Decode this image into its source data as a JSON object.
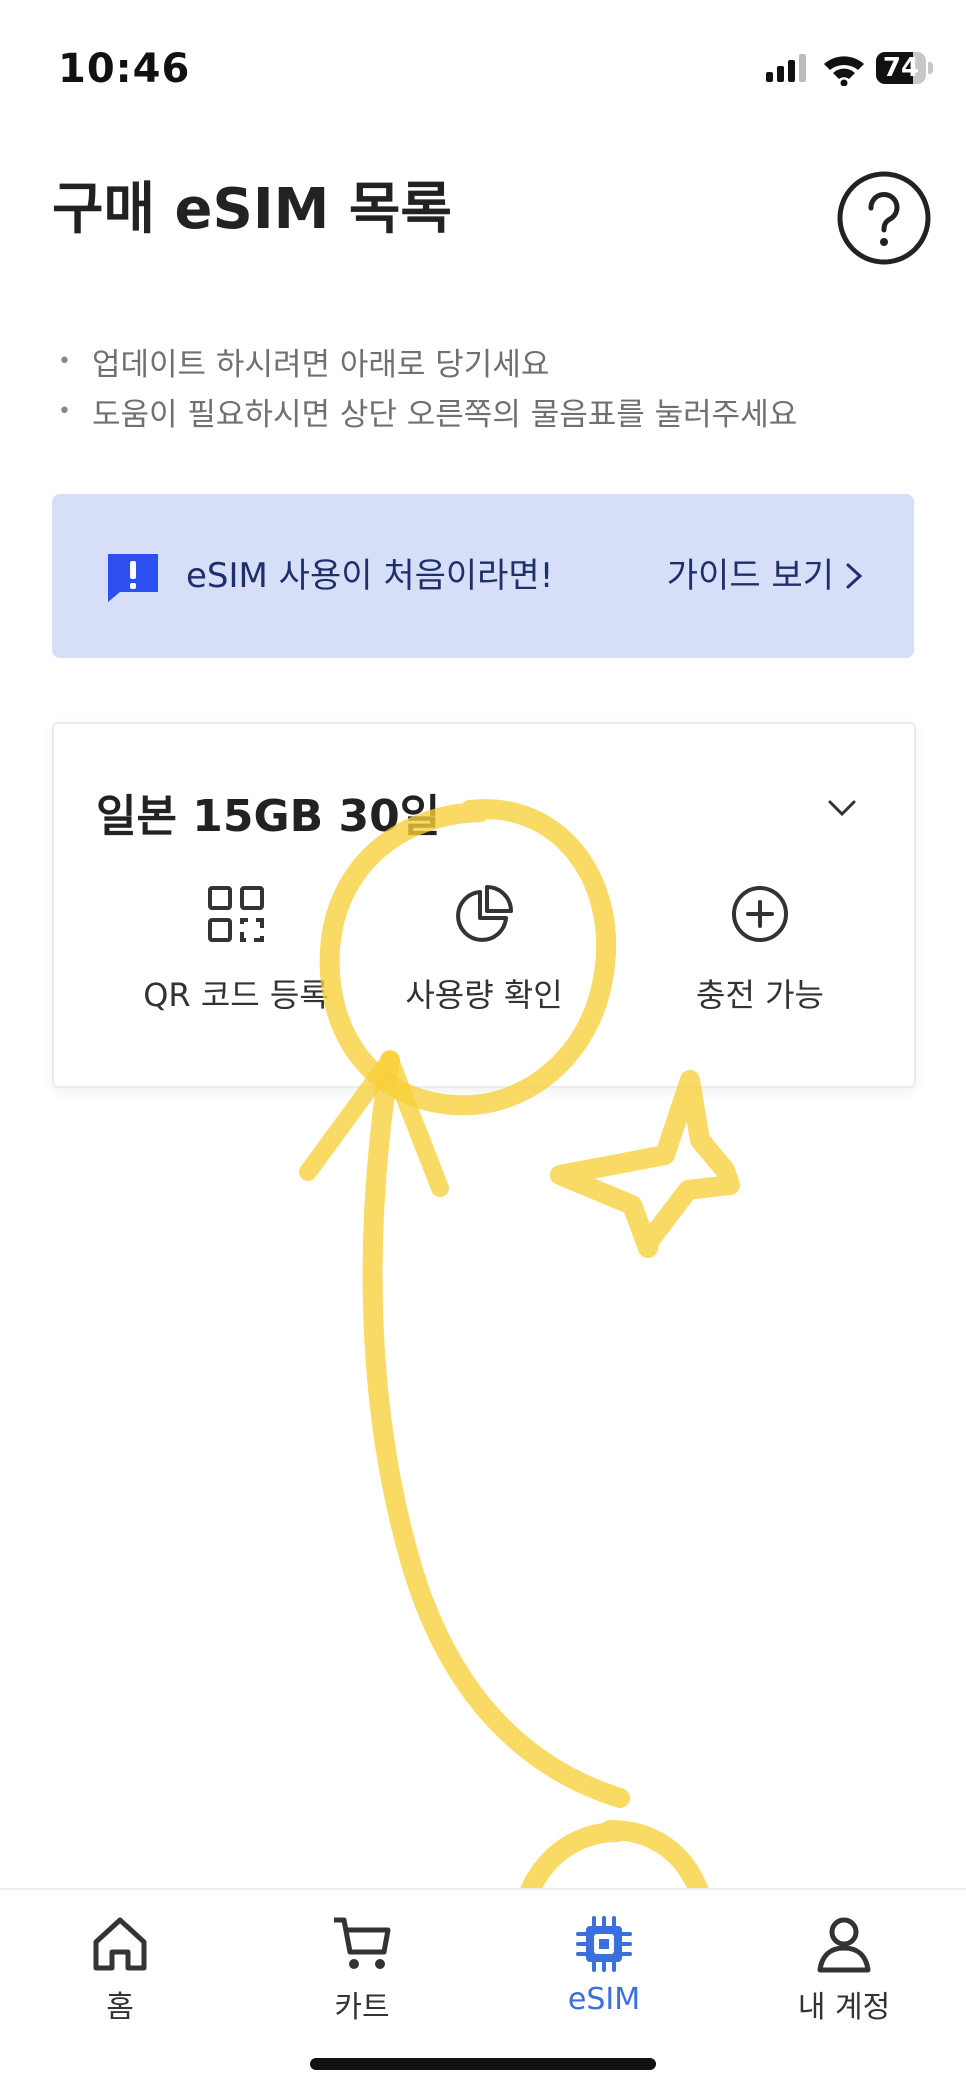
{
  "status_bar": {
    "time": "10:46",
    "battery_percent": "74",
    "battery_level": 0.74
  },
  "header": {
    "title": "구매 eSIM 목록",
    "help_icon": "question-circle-icon"
  },
  "tips": [
    "업데이트 하시려면 아래로 당기세요",
    "도움이 필요하시면 상단 오른쪽의 물음표를 눌러주세요"
  ],
  "guide_banner": {
    "text": "eSIM 사용이 처음이라면!",
    "link_label": "가이드 보기",
    "link_icon": "chevron-right-icon",
    "color": "#d6def8"
  },
  "esim_card": {
    "title": "일본 15GB 30일",
    "actions": [
      {
        "label": "QR 코드 등록",
        "icon": "qr-scan-icon"
      },
      {
        "label": "사용량 확인",
        "icon": "pie-chart-icon"
      },
      {
        "label": "충전 가능",
        "icon": "plus-circle-icon"
      }
    ]
  },
  "tab_bar": {
    "active_color": "#3a6fe0",
    "tabs": [
      {
        "label": "홈",
        "icon": "home-icon"
      },
      {
        "label": "카트",
        "icon": "cart-icon"
      },
      {
        "label": "eSIM",
        "icon": "chip-icon",
        "active": true
      },
      {
        "label": "내 계정",
        "icon": "person-icon"
      }
    ]
  },
  "annotations": {
    "highlight_color": "#f7cf3a"
  }
}
